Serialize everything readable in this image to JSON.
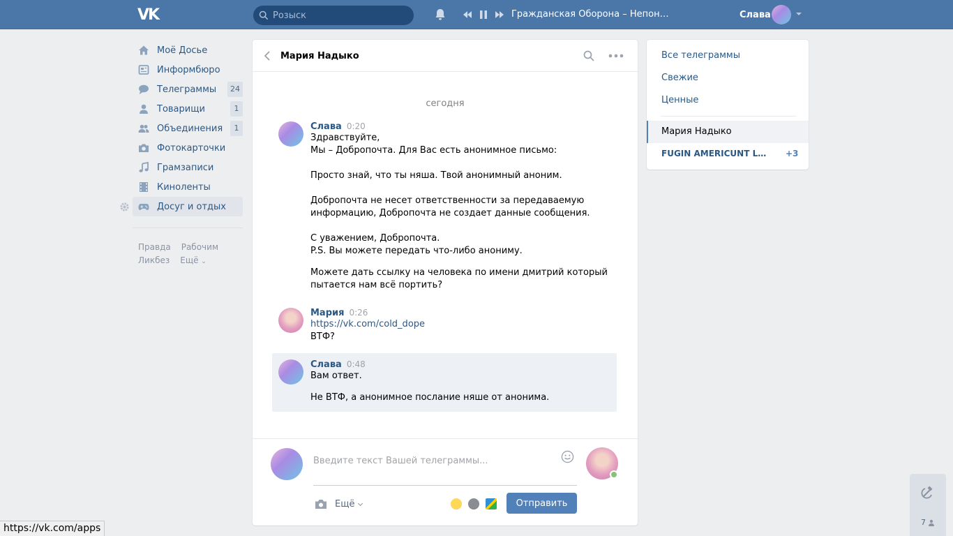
{
  "topbar": {
    "search_placeholder": "Розыск",
    "track_title": "Гражданская Оборона – Непонятн…",
    "user_name": "Слава"
  },
  "leftnav": {
    "items": [
      {
        "label": "Моё Досье",
        "icon": "home-icon",
        "badge": ""
      },
      {
        "label": "Информбюро",
        "icon": "news-icon",
        "badge": ""
      },
      {
        "label": "Телеграммы",
        "icon": "messages-icon",
        "badge": "24"
      },
      {
        "label": "Товарищи",
        "icon": "friend-icon",
        "badge": "1"
      },
      {
        "label": "Объединения",
        "icon": "groups-icon",
        "badge": "1"
      },
      {
        "label": "Фотокарточки",
        "icon": "camera-icon",
        "badge": ""
      },
      {
        "label": "Грамзаписи",
        "icon": "music-icon",
        "badge": ""
      },
      {
        "label": "Киноленты",
        "icon": "film-icon",
        "badge": ""
      },
      {
        "label": "Досуг и отдых",
        "icon": "gamepad-icon",
        "badge": ""
      }
    ],
    "footer_links": [
      "Правда",
      "Рабочим",
      "Ликбез",
      "Ещё"
    ]
  },
  "chat": {
    "title": "Мария Надыко",
    "date_separator": "сегодня",
    "messages": [
      {
        "author": "Слава",
        "time": "0:20",
        "lines": [
          "Здравствуйте,",
          "Мы – Добропочта. Для Вас есть анонимное письмо:",
          "",
          "Просто знай, что ты няша. Твой анонимный аноним.",
          "",
          "Добропочта не несет ответственности за передаваемую",
          "информацию, Добропочта не создает данные сообщения.",
          "",
          "С уважением, Добропочта.",
          "P.S. Вы можете передать что-либо анониму."
        ],
        "extra_lines": [
          "Можете дать ссылку на человека по имени дмитрий который",
          "пытается нам всё портить?"
        ]
      },
      {
        "author": "Мария",
        "time": "0:26",
        "link": "https://vk.com/cold_dope",
        "lines": [
          "ВТФ?"
        ]
      },
      {
        "author": "Слава",
        "time": "0:48",
        "lines": [
          "Вам ответ.",
          "",
          "Не ВТФ, а анонимное послание няше от анонима."
        ]
      }
    ]
  },
  "composer": {
    "placeholder": "Введите текст Вашей телеграммы...",
    "more_label": "Ещё",
    "send_label": "Отправить"
  },
  "rightmenu": {
    "items": [
      "Все телеграммы",
      "Свежие",
      "Ценные"
    ],
    "active_conversation": "Мария Надыко",
    "group_chat": "FUGIN AMERICUNT LAN...",
    "group_chat_extra": "+3"
  },
  "widget": {
    "count": "7"
  },
  "statusbar": {
    "url": "https://vk.com/apps"
  },
  "colors": {
    "header": "#4a76a8",
    "link": "#2a5885",
    "button": "#5181b8",
    "background": "#edeef0"
  }
}
